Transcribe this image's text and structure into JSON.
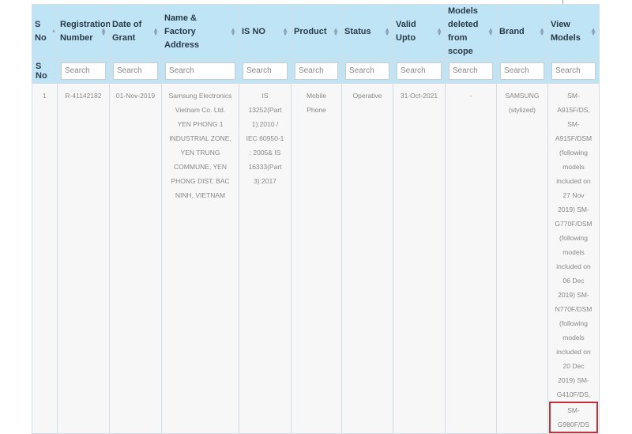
{
  "columns": [
    "S No",
    "Registration Number",
    "Date of Grant",
    "Name & Factory Address",
    "IS NO",
    "Product",
    "Status",
    "Valid Upto",
    "Models deleted from scope",
    "Brand",
    "View Models"
  ],
  "search_row": {
    "label": "S No",
    "placeholder": "Search"
  },
  "row": {
    "s_no": "1",
    "registration": "R-41142182",
    "date": "01-Nov-2019",
    "address_lines": [
      "Samsung Electronics",
      "Vietnam Co. Ltd.",
      "YEN PHONG 1",
      "INDUSTRIAL ZONE,",
      "YEN TRUNG",
      "COMMUNE, YEN",
      "PHONG DIST, BAC",
      "NINH, VIETNAM"
    ],
    "is_no_lines": [
      "IS",
      "13252(Part",
      "1):2010 /",
      "IEC 60950-1",
      ": 2005& IS",
      "16333(Part",
      "3):2017"
    ],
    "product_lines": [
      "Mobile",
      "Phone"
    ],
    "status": "Operative",
    "valid_upto": "31-Oct-2021",
    "models_deleted": "-",
    "brand_lines": [
      "SAMSUNG",
      "(stylized)"
    ],
    "models_lines": [
      "SM-",
      "A915F/DS,",
      "SM-",
      "A915F/DSM",
      "(following",
      "models",
      "included on",
      "27 Nov",
      "2019) SM-",
      "G770F/DSM",
      "(following",
      "models",
      "included on",
      "06 Dec",
      "2019) SM-",
      "N770F/DSM",
      "(following",
      "models",
      "included on",
      "20 Dec",
      "2019) SM-",
      "G410F/DS,"
    ],
    "highlighted_lines": [
      "SM-",
      "G980F/DS"
    ]
  },
  "colors": {
    "header": "#bfe4f6",
    "highlight": "#c0313a"
  }
}
